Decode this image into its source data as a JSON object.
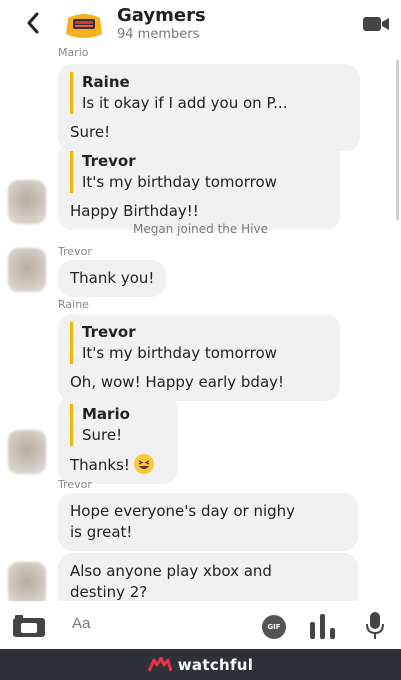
{
  "header": {
    "group_name": "Gaymers",
    "member_count": "94 members"
  },
  "messages": {
    "m1_sender": "Mario",
    "m1_quote_name": "Raine",
    "m1_quote_text": "Is it okay if I add you on P...",
    "m1_text": "Sure!",
    "m2_quote_name": "Trevor",
    "m2_quote_text": "It's my birthday tomorrow",
    "m2_text": "Happy Birthday!!",
    "system_text": "Megan joined the Hive",
    "m3_sender": "Trevor",
    "m3_text": "Thank you!",
    "m4_sender": "Raine",
    "m4_quote_name": "Trevor",
    "m4_quote_text": "It's my birthday tomorrow",
    "m4_text": "Oh, wow! Happy early bday!",
    "m5_quote_name": "Mario",
    "m5_quote_text": "Sure!",
    "m5_text": "Thanks!",
    "m6_sender": "Trevor",
    "m6_text_line1": "Hope everyone's day or nighy",
    "m6_text_line2": "is great!",
    "m7_text_line1": "Also anyone play xbox and",
    "m7_text_line2": "destiny 2?"
  },
  "composer": {
    "placeholder": "Aa",
    "gif_label": "GIF"
  },
  "footer": {
    "brand": "watchful"
  },
  "colors": {
    "quote_bar": "#f4b400",
    "bubble_bg": "#f1f1f1",
    "footer_bg": "#2f3138",
    "brand_red": "#e8314a"
  }
}
